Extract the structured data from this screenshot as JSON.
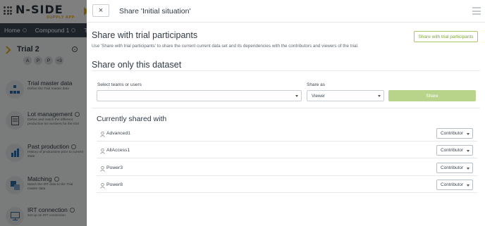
{
  "app": {
    "logo_main": "N-SIDE",
    "logo_sub": "SUPPLY APP",
    "nav": [
      "Home",
      "Compound 1",
      "Trial"
    ],
    "trial": {
      "title": "Trial 2",
      "avatars": [
        "A",
        "P",
        "P",
        "+3"
      ]
    },
    "sidebar_items": [
      {
        "title": "Trial master data",
        "desc": "Define the Trial master data",
        "icon": "hierarchy-icon"
      },
      {
        "title": "Lot management",
        "desc": "Define and match the different production lot numbers for the trial",
        "icon": "document-icon"
      },
      {
        "title": "Past production",
        "desc": "History of productions prior to current state",
        "icon": "chart-icon"
      },
      {
        "title": "Matching",
        "desc": "Match the IRT data to the Trial master data",
        "icon": "match-icon"
      },
      {
        "title": "IRT connection",
        "desc": "Set up an IRT connection",
        "icon": "monitor-icon"
      }
    ]
  },
  "modal": {
    "close_label": "×",
    "title": "Share 'Initial situation'",
    "share_trial": {
      "heading": "Share with trial participants",
      "description": "Use 'Share with trial participants' to share the current current data set and its dependencies with the contributors and viewers of the trial.",
      "button_label": "Share with trial participants"
    },
    "share_only": {
      "heading": "Share only this dataset",
      "teams_label": "Select teams or users",
      "teams_value": "",
      "share_as_label": "Share as",
      "share_as_value": "Viewer",
      "share_button": "Share"
    },
    "currently_shared": {
      "heading": "Currently shared with",
      "rows": [
        {
          "name": "Advanced1",
          "role": "Contributor"
        },
        {
          "name": "AllAccess1",
          "role": "Contributor"
        },
        {
          "name": "Power3",
          "role": "Contributor"
        },
        {
          "name": "Power8",
          "role": "Contributor"
        }
      ]
    }
  },
  "colors": {
    "accent_green": "#7ea53c",
    "share_button_green": "#b8d48b",
    "nav_bg": "#3d4754",
    "overlay": "rgba(0,0,0,0.5)"
  }
}
